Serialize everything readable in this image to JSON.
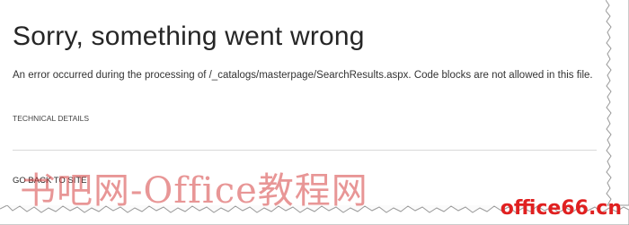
{
  "error_page": {
    "title": "Sorry, something went wrong",
    "message": "An error occurred during the processing of /_catalogs/masterpage/SearchResults.aspx. Code blocks are not allowed in this file.",
    "technical_details_label": "TECHNICAL DETAILS",
    "go_back_label": "GO BACK TO SITE"
  },
  "overlays": {
    "watermark_text": "书吧网-Office教程网",
    "site_mark_name": "office66",
    "site_mark_suffix": ".cn"
  },
  "colors": {
    "title": "#262626",
    "text": "#333333",
    "divider": "#d9d9d9",
    "watermark": "#d64040",
    "site_mark": "#e02020"
  }
}
